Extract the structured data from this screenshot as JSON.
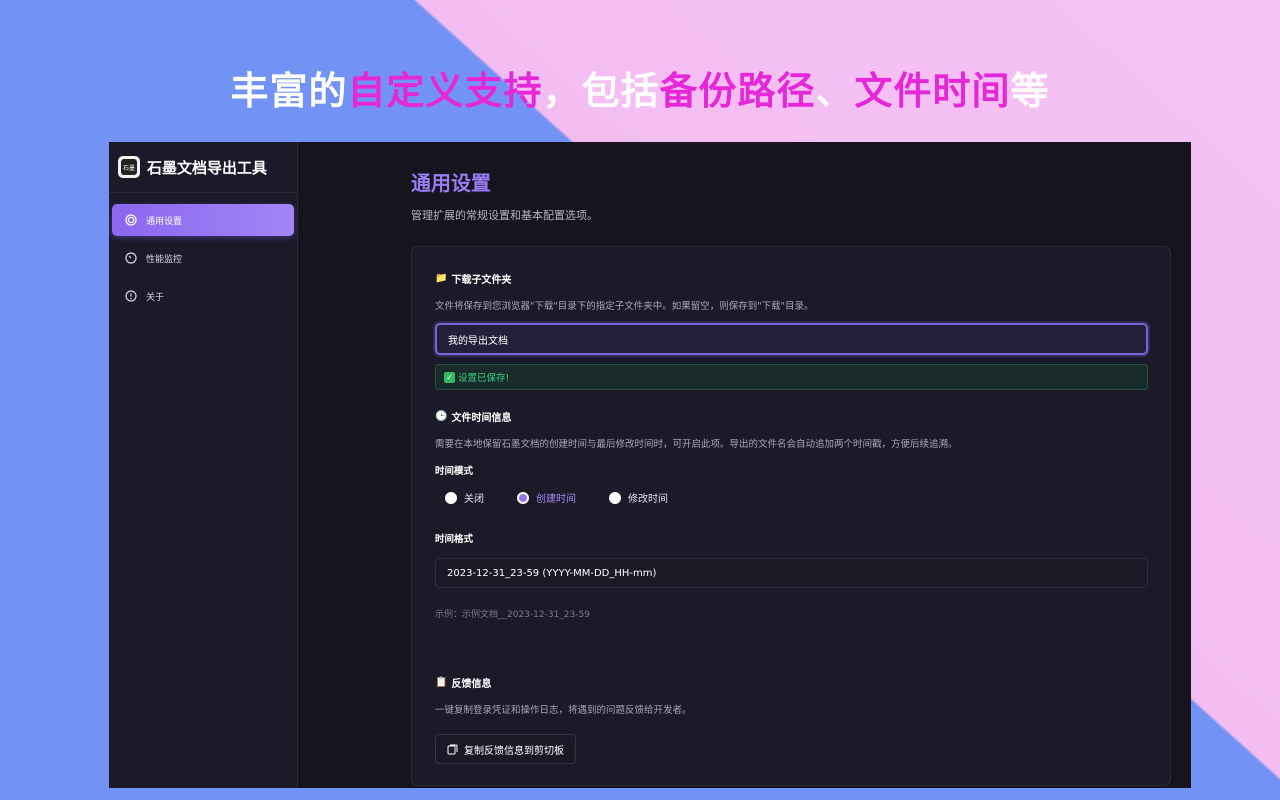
{
  "banner": {
    "part1": "丰富的",
    "part2": "自定义支持",
    "part3": "，包括",
    "part4": "备份路径",
    "part5": "、",
    "part6": "文件时间",
    "part7": "等"
  },
  "app": {
    "logo_text": "石墨",
    "title": "石墨文档导出工具"
  },
  "sidebar": {
    "items": [
      {
        "label": "通用设置",
        "icon": "settings-ring-icon",
        "active": true
      },
      {
        "label": "性能监控",
        "icon": "speedometer-icon",
        "active": false
      },
      {
        "label": "关于",
        "icon": "info-icon",
        "active": false
      }
    ]
  },
  "page": {
    "title": "通用设置",
    "description": "管理扩展的常规设置和基本配置选项。"
  },
  "download": {
    "emoji": "📁",
    "title": "下载子文件夹",
    "description": "文件将保存到您浏览器\"下载\"目录下的指定子文件夹中。如果留空，则保存到\"下载\"目录。",
    "input_value": "我的导出文档",
    "success_icon": "✓",
    "success_text": "设置已保存!"
  },
  "file_time": {
    "emoji": "🕒",
    "title": "文件时间信息",
    "description": "需要在本地保留石墨文档的创建时间与最后修改时间时，可开启此项。导出的文件名会自动追加两个时间戳，方便后续追溯。",
    "mode_label": "时间模式",
    "modes": [
      {
        "label": "关闭",
        "checked": false
      },
      {
        "label": "创建时间",
        "checked": true
      },
      {
        "label": "修改时间",
        "checked": false
      }
    ],
    "format_label": "时间格式",
    "format_value": "2023-12-31_23-59 (YYYY-MM-DD_HH-mm)",
    "example": "示例：示例文档__2023-12-31_23-59"
  },
  "feedback": {
    "emoji": "📋",
    "title": "反馈信息",
    "description": "一键复制登录凭证和操作日志，将遇到的问题反馈给开发者。",
    "button_label": "复制反馈信息到剪切板"
  },
  "colors": {
    "accent": "#9a7cf3",
    "highlight": "#e627d9",
    "success": "#35d07f"
  }
}
